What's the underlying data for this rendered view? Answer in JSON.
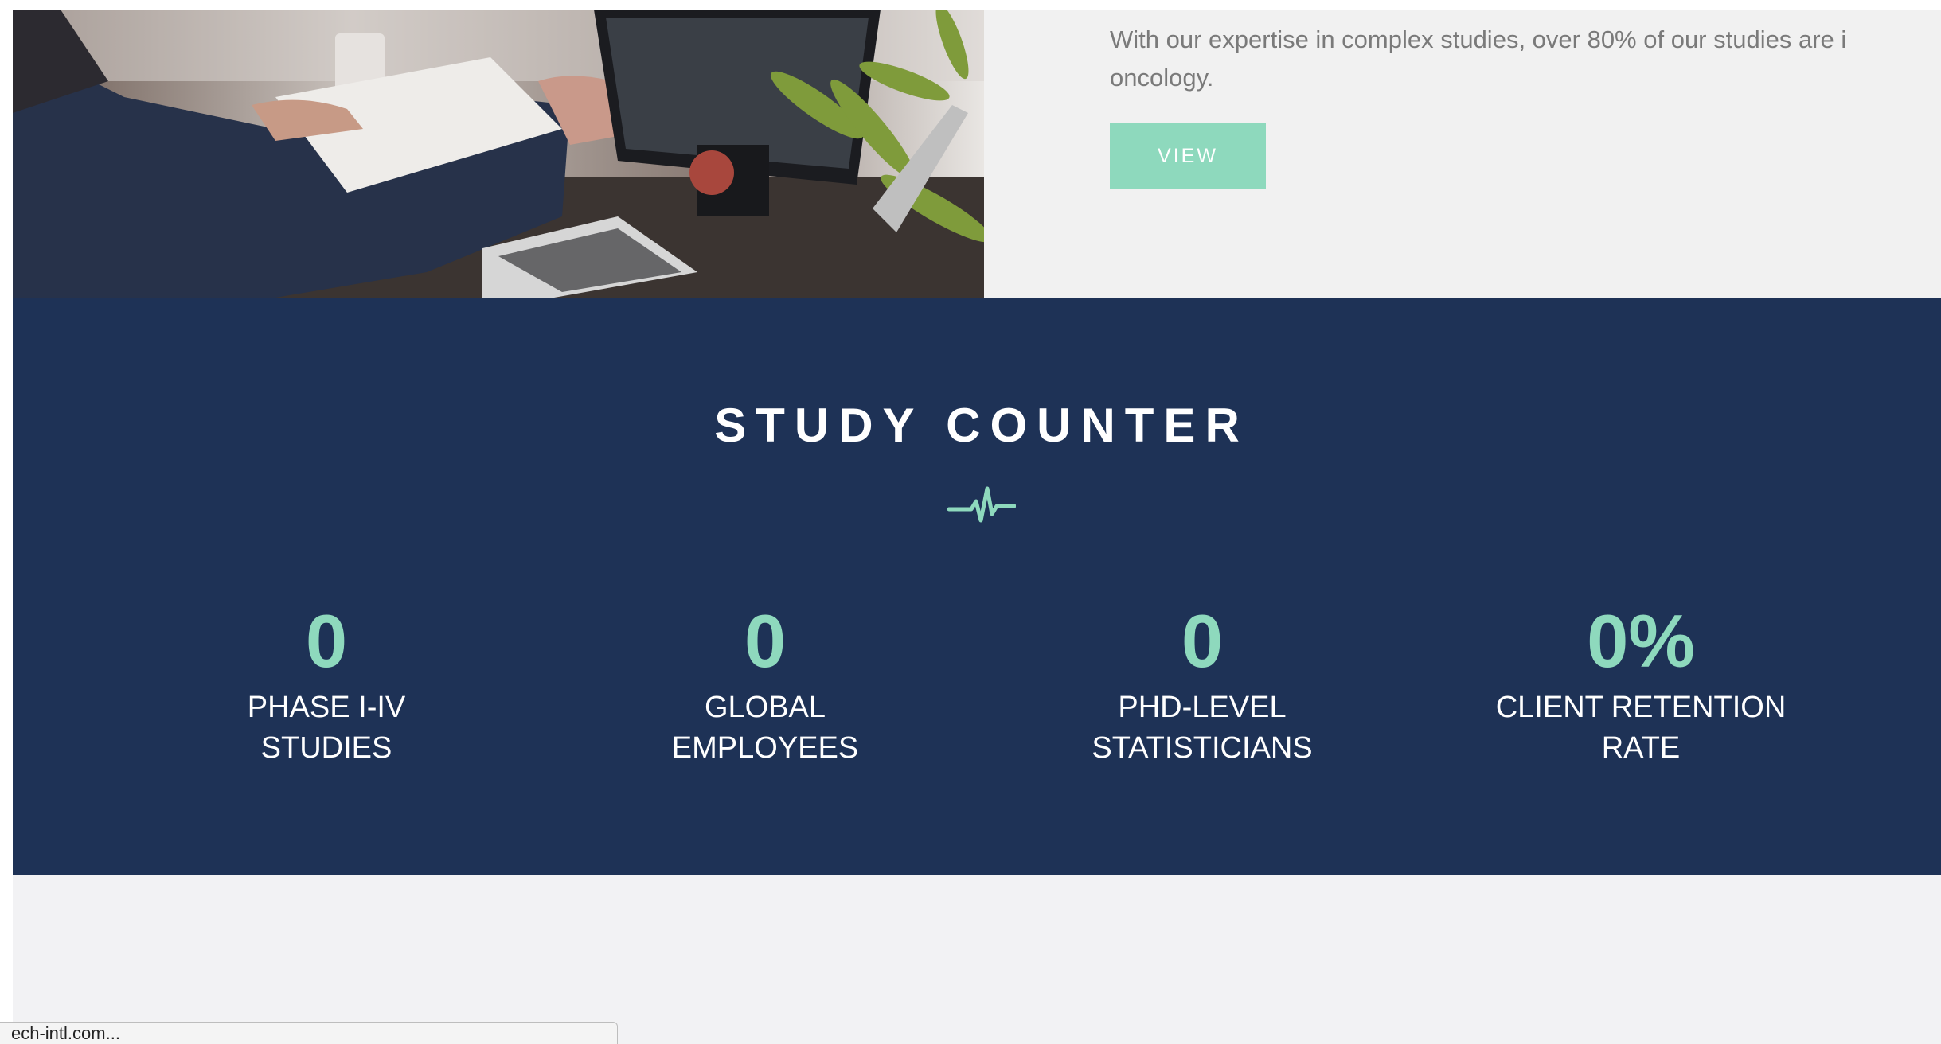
{
  "intro": {
    "text_line1": "With our expertise in complex studies, over 80% of our studies are i",
    "text_line2": "oncology.",
    "view_label": "VIEW"
  },
  "study_counter": {
    "title": "STUDY COUNTER",
    "icon": "heartbeat-pulse-icon",
    "stats": [
      {
        "value": "0",
        "label_line1": "PHASE I-IV",
        "label_line2": "STUDIES"
      },
      {
        "value": "0",
        "label_line1": "GLOBAL",
        "label_line2": "EMPLOYEES"
      },
      {
        "value": "0",
        "label_line1": "PHD-LEVEL",
        "label_line2": "STATISTICIANS"
      },
      {
        "value": "0%",
        "label_line1": "CLIENT RETENTION",
        "label_line2": "RATE"
      }
    ]
  },
  "status_bar": {
    "url_text": "ech-intl.com..."
  },
  "colors": {
    "navy_band": "#1e3256",
    "accent_mint": "#8ed9bd",
    "intro_bg": "#f1f1f1",
    "body_text_gray": "#7a7a7a"
  }
}
